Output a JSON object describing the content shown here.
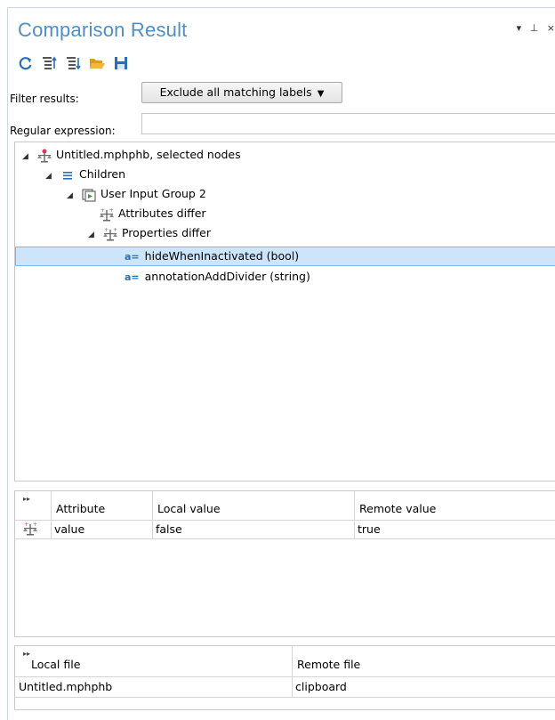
{
  "panel": {
    "title": "Comparison Result",
    "window_controls": {
      "menu": "▾",
      "pin": "⊥",
      "close": "×"
    }
  },
  "toolbar": {
    "buttons": [
      {
        "name": "refresh-icon"
      },
      {
        "name": "expand-all-icon"
      },
      {
        "name": "collapse-all-icon"
      },
      {
        "name": "open-folder-icon"
      },
      {
        "name": "save-icon"
      }
    ]
  },
  "filter": {
    "label": "Filter results:",
    "selected": "Exclude all matching labels",
    "arrow": "▼"
  },
  "regex": {
    "label": "Regular expression:",
    "value": ""
  },
  "tree": {
    "root": {
      "expander": "◢",
      "label": "Untitled.mphphb, selected nodes"
    },
    "children": {
      "expander": "◢",
      "label": "Children"
    },
    "group": {
      "expander": "◢",
      "label": "User Input Group 2"
    },
    "attributes": {
      "label": "Attributes differ"
    },
    "properties": {
      "expander": "◢",
      "label": "Properties differ"
    },
    "prop1": {
      "prefix": "a=",
      "label": "hideWhenInactivated (bool)"
    },
    "prop2": {
      "prefix": "a=",
      "label": "annotationAddDivider (string)"
    }
  },
  "attr_table": {
    "headers": [
      "Attribute",
      "Local value",
      "Remote value"
    ],
    "rows": [
      {
        "attribute": "value",
        "local": "false",
        "remote": "true"
      }
    ]
  },
  "file_table": {
    "headers": [
      "Local file",
      "Remote file"
    ],
    "rows": [
      {
        "local": "Untitled.mphphb",
        "remote": "clipboard"
      }
    ]
  },
  "colors": {
    "title": "#4d8fc6",
    "selection_bg": "#cde5fb",
    "selection_border": "#7fb6e8",
    "accent_blue": "#2a6fb4",
    "orange": "#f0a030"
  }
}
